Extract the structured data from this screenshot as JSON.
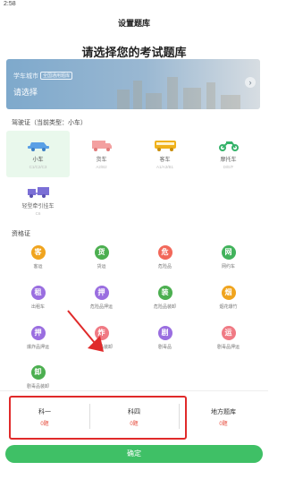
{
  "status_bar": {
    "time": "2:58"
  },
  "header": {
    "title": "设置题库"
  },
  "page_title": "请选择您的考试题库",
  "banner": {
    "city_label": "学车城市",
    "city_badge": "全国通用题库",
    "choose": "请选择"
  },
  "license_section": {
    "title": "驾驶证（当前类型：小车）",
    "vehicles": [
      {
        "name": "小车",
        "sub": "C1/C2/C3",
        "selected": true,
        "icon": "car-icon",
        "color": "#5aa0e6"
      },
      {
        "name": "货车",
        "sub": "A2/B2",
        "selected": false,
        "icon": "truck-icon",
        "color": "#f3a0a0"
      },
      {
        "name": "客车",
        "sub": "A1/A3/B1",
        "selected": false,
        "icon": "bus-icon",
        "color": "#f0b21c"
      },
      {
        "name": "摩托车",
        "sub": "D/E/F",
        "selected": false,
        "icon": "motorcycle-icon",
        "color": "#36b36a"
      },
      {
        "name": "轻型牵引挂车",
        "sub": "C6",
        "selected": false,
        "icon": "trailer-icon",
        "color": "#7b6fd6"
      }
    ]
  },
  "qualification_section": {
    "title": "资格证",
    "items": [
      {
        "char": "客",
        "label": "客运",
        "color": "#f0a41e"
      },
      {
        "char": "货",
        "label": "货运",
        "color": "#4caf50"
      },
      {
        "char": "危",
        "label": "危险品",
        "color": "#f2685a"
      },
      {
        "char": "网",
        "label": "网约车",
        "color": "#42b35c"
      },
      {
        "char": "租",
        "label": "出租车",
        "color": "#9a6ee0"
      },
      {
        "char": "押",
        "label": "危险品押运",
        "color": "#9a6ee0"
      },
      {
        "char": "装",
        "label": "危险品装卸",
        "color": "#4caf50"
      },
      {
        "char": "烟",
        "label": "烟花爆竹",
        "color": "#f0a41e"
      },
      {
        "char": "押",
        "label": "爆炸品押运",
        "color": "#9a6ee0"
      },
      {
        "char": "炸",
        "label": "爆炸品装卸",
        "color": "#f07a84"
      },
      {
        "char": "剧",
        "label": "剧毒品",
        "color": "#9a6ee0"
      },
      {
        "char": "运",
        "label": "剧毒品押运",
        "color": "#f07a84"
      },
      {
        "char": "卸",
        "label": "剧毒品装卸",
        "color": "#4caf50"
      }
    ]
  },
  "subjects": [
    {
      "name": "科一",
      "count": "0题"
    },
    {
      "name": "科四",
      "count": "0题"
    },
    {
      "name": "地方题库",
      "count": "0题"
    }
  ],
  "confirm": "确定",
  "colors": {
    "accent": "#3fc066",
    "annotation": "#e02a2a",
    "count": "#e64a3a"
  }
}
